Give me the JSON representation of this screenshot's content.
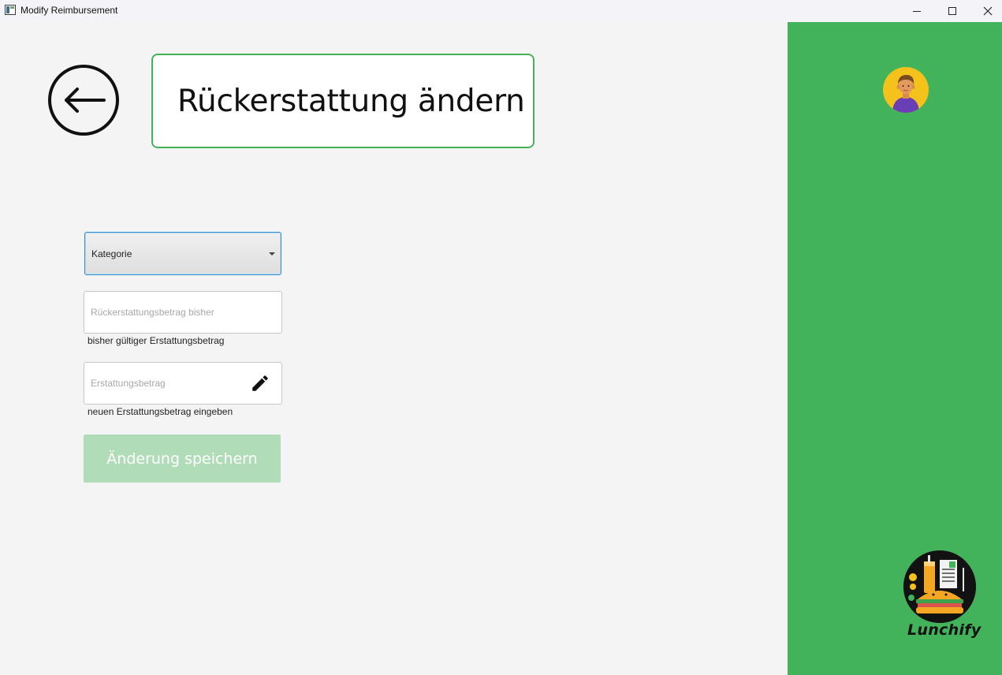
{
  "window": {
    "title": "Modify Reimbursement"
  },
  "header": {
    "title": "Rückerstattung ändern"
  },
  "form": {
    "category": {
      "label": "Kategorie"
    },
    "previous_amount": {
      "placeholder": "Rückerstattungsbetrag bisher",
      "value": "",
      "helper": "bisher gültiger Erstattungsbetrag"
    },
    "new_amount": {
      "placeholder": "Erstattungsbetrag",
      "value": "",
      "helper": "neuen Erstattungsbetrag eingeben"
    },
    "save_label": "Änderung speichern"
  },
  "sidebar": {
    "brand": "Lunchify"
  },
  "colors": {
    "accent": "#43b35b",
    "save_disabled": "#b1dcb8",
    "avatar_bg": "#f5c21b"
  },
  "icons": {
    "back": "arrow-left-circle-icon",
    "edit": "pencil-icon",
    "profile": "user-avatar-icon"
  }
}
